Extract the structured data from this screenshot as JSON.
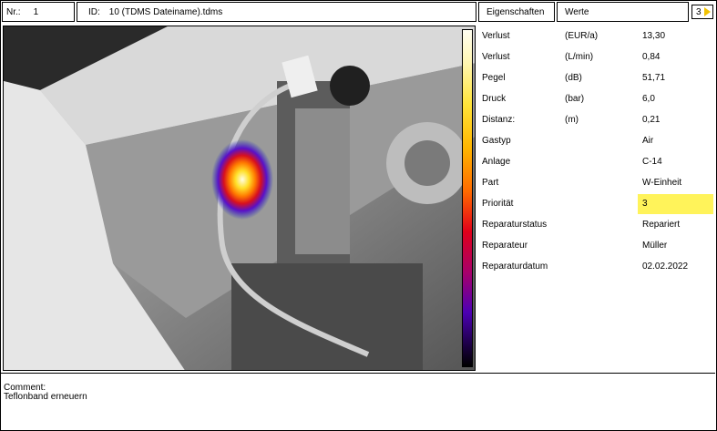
{
  "header": {
    "nr_label": "Nr.:",
    "nr_value": "1",
    "id_label": "ID:",
    "id_value": "10 (TDMS Dateiname).tdms",
    "tab_properties": "Eigenschaften",
    "tab_values": "Werte",
    "page_indicator": "3"
  },
  "properties": [
    {
      "key": "Verlust",
      "unit": "(EUR/a)",
      "value": "13,30",
      "key_color": "#000000"
    },
    {
      "key": "Verlust",
      "unit": "(L/min)",
      "value": "0,84",
      "key_color": "#000000"
    },
    {
      "key": "Pegel",
      "unit": "(dB)",
      "value": "51,71",
      "key_color": "#000000"
    },
    {
      "key": "Druck",
      "unit": "(bar)",
      "value": "6,0",
      "key_color": "#000000"
    },
    {
      "key": "Distanz:",
      "unit": "(m)",
      "value": "0,21",
      "key_color": "#000000"
    },
    {
      "key": "Gastyp",
      "unit": "",
      "value": "Air",
      "key_color": "#000000"
    },
    {
      "key": "Anlage",
      "unit": "",
      "value": "C-14",
      "key_color": "#000000"
    },
    {
      "key": "Part",
      "unit": "",
      "value": "W-Einheit",
      "key_color": "#000000"
    },
    {
      "key": "Priorität",
      "unit": "",
      "value": "3",
      "key_color": "#000000",
      "highlight": "#fff35a"
    },
    {
      "key": "Reparaturstatus",
      "unit": "",
      "value": "Repariert",
      "key_color": "#000000"
    },
    {
      "key": "Reparateur",
      "unit": "",
      "value": "Müller",
      "key_color": "#000000"
    },
    {
      "key": "Reparaturdatum",
      "unit": "",
      "value": "02.02.2022",
      "key_color": "#000000"
    }
  ],
  "comment": {
    "label": "Comment:",
    "text": "Teflonband erneuern"
  },
  "colors": {
    "highlight": "#fff35a",
    "page_chevron": "#f2c200"
  },
  "image": {
    "colorbar": "hot-cold gradient (white to black)"
  }
}
